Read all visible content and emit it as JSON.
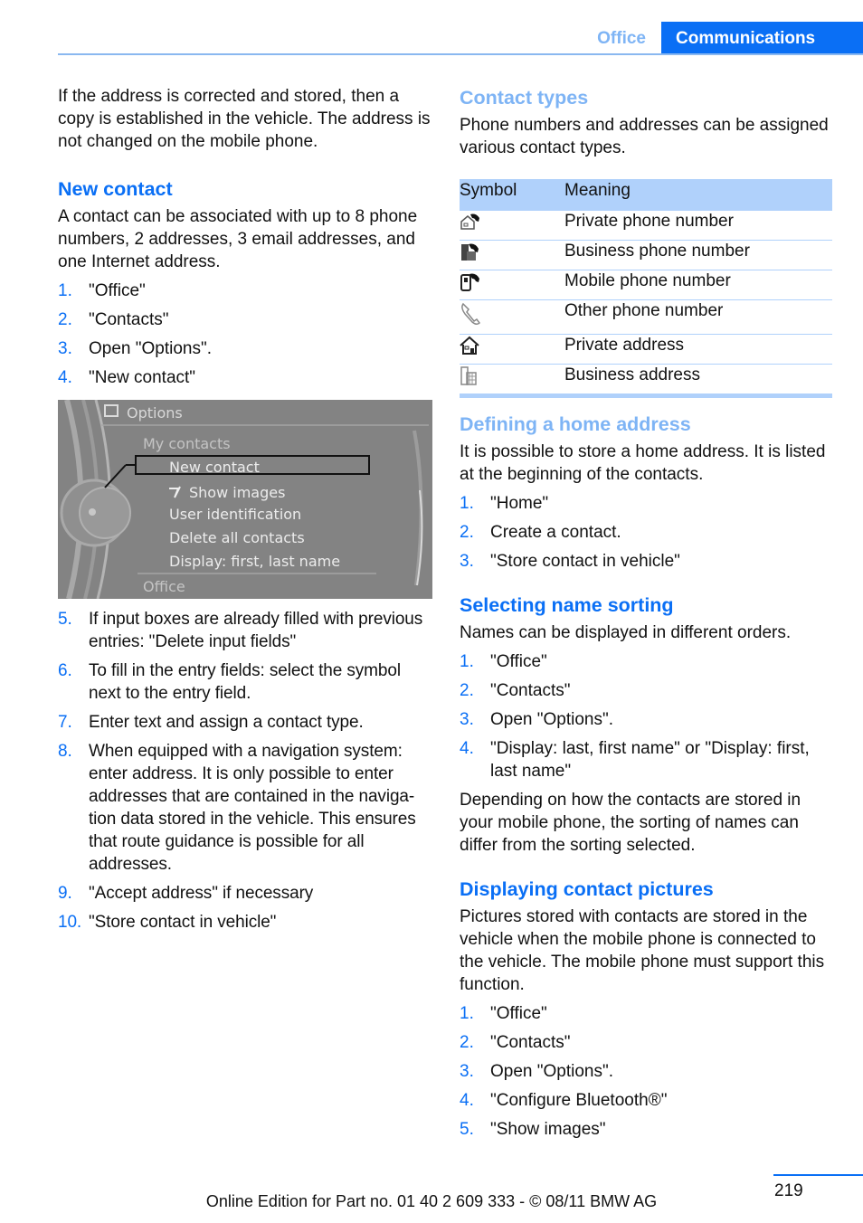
{
  "header": {
    "section_tab": "Office",
    "chapter_tab": "Communications"
  },
  "left": {
    "intro": "If the address is corrected and stored, then a copy is established in the vehicle. The address is not changed on the mobile phone.",
    "new_contact": {
      "heading": "New contact",
      "text": "A contact can be associated with up to 8 phone numbers, 2 addresses, 3 email addresses, and one Internet address.",
      "steps_a": [
        {
          "num": "1.",
          "text": "\"Office\""
        },
        {
          "num": "2.",
          "text": "\"Contacts\""
        },
        {
          "num": "3.",
          "text": "Open \"Options\"."
        },
        {
          "num": "4.",
          "text": "\"New contact\""
        }
      ],
      "screen": {
        "title": "Options",
        "items": [
          "My contacts",
          "New contact",
          "Show images",
          "User identification",
          "Delete all contacts",
          "Display: first, last name"
        ],
        "footer": "Office"
      },
      "steps_b": [
        {
          "num": "5.",
          "text": "If input boxes are already filled with previous entries: \"Delete input fields\""
        },
        {
          "num": "6.",
          "text": "To fill in the entry fields: select the symbol next to the entry field."
        },
        {
          "num": "7.",
          "text": "Enter text and assign a contact type."
        },
        {
          "num": "8.",
          "text": "When equipped with a navigation system: enter address. It is only possible to enter addresses that are contained in the naviga-tion data stored in the vehicle. This ensures that route guidance is possible for all addresses."
        },
        {
          "num": "9.",
          "text": "\"Accept address\" if necessary"
        },
        {
          "num": "10.",
          "text": "\"Store contact in vehicle\""
        }
      ]
    }
  },
  "right": {
    "contact_types": {
      "heading": "Contact types",
      "text": "Phone numbers and addresses can be assigned various contact types.",
      "table": {
        "headers": [
          "Symbol",
          "Meaning"
        ],
        "rows": [
          {
            "icon": "private-phone-icon",
            "meaning": "Private phone number"
          },
          {
            "icon": "business-phone-icon",
            "meaning": "Business phone number"
          },
          {
            "icon": "mobile-phone-icon",
            "meaning": "Mobile phone number"
          },
          {
            "icon": "other-phone-icon",
            "meaning": "Other phone number"
          },
          {
            "icon": "private-address-icon",
            "meaning": "Private address"
          },
          {
            "icon": "business-address-icon",
            "meaning": "Business address"
          }
        ]
      }
    },
    "home_address": {
      "heading": "Defining a home address",
      "text": "It is possible to store a home address. It is listed at the beginning of the contacts.",
      "steps": [
        {
          "num": "1.",
          "text": "\"Home\""
        },
        {
          "num": "2.",
          "text": "Create a contact."
        },
        {
          "num": "3.",
          "text": "\"Store contact in vehicle\""
        }
      ]
    },
    "name_sorting": {
      "heading": "Selecting name sorting",
      "text": "Names can be displayed in different orders.",
      "steps": [
        {
          "num": "1.",
          "text": "\"Office\""
        },
        {
          "num": "2.",
          "text": "\"Contacts\""
        },
        {
          "num": "3.",
          "text": "Open \"Options\"."
        },
        {
          "num": "4.",
          "text": "\"Display: last, first name\" or \"Display: first, last name\""
        }
      ],
      "note": "Depending on how the contacts are stored in your mobile phone, the sorting of names can differ from the sorting selected."
    },
    "contact_pictures": {
      "heading": "Displaying contact pictures",
      "text": "Pictures stored with contacts are stored in the vehicle when the mobile phone is connected to the vehicle. The mobile phone must support this function.",
      "steps": [
        {
          "num": "1.",
          "text": "\"Office\""
        },
        {
          "num": "2.",
          "text": "\"Contacts\""
        },
        {
          "num": "3.",
          "text": "Open \"Options\"."
        },
        {
          "num": "4.",
          "text": "\"Configure Bluetooth®\""
        },
        {
          "num": "5.",
          "text": "\"Show images\""
        }
      ]
    }
  },
  "footer": {
    "edition": "Online Edition for Part no. 01 40 2 609 333 - © 08/11 BMW AG",
    "page_number": "219"
  },
  "colors": {
    "accent": "#0a6ff5",
    "accent_light": "#7eb4f5",
    "table_header_bg": "#b0d1fb"
  }
}
